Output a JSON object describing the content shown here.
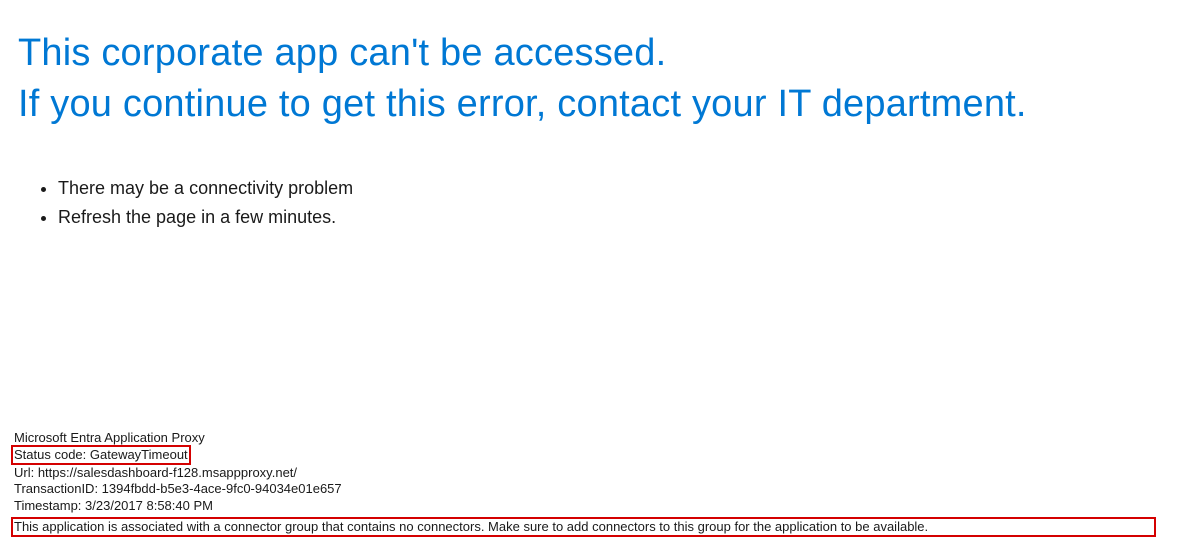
{
  "heading": {
    "line1": "This corporate app can't be accessed.",
    "line2": "If you continue to get this error, contact your IT department."
  },
  "bullets": {
    "item1": "There may be a connectivity problem",
    "item2": "Refresh the page in a few minutes."
  },
  "details": {
    "service": "Microsoft Entra Application Proxy",
    "status_code": "Status code: GatewayTimeout",
    "url": "Url: https://salesdashboard-f128.msappproxy.net/",
    "transaction_id": "TransactionID: 1394fbdd-b5e3-4ace-9fc0-94034e01e657",
    "timestamp": "Timestamp: 3/23/2017 8:58:40 PM",
    "message": "This application is associated with a connector group that contains no connectors. Make sure to add connectors to this group for the application to be available."
  }
}
